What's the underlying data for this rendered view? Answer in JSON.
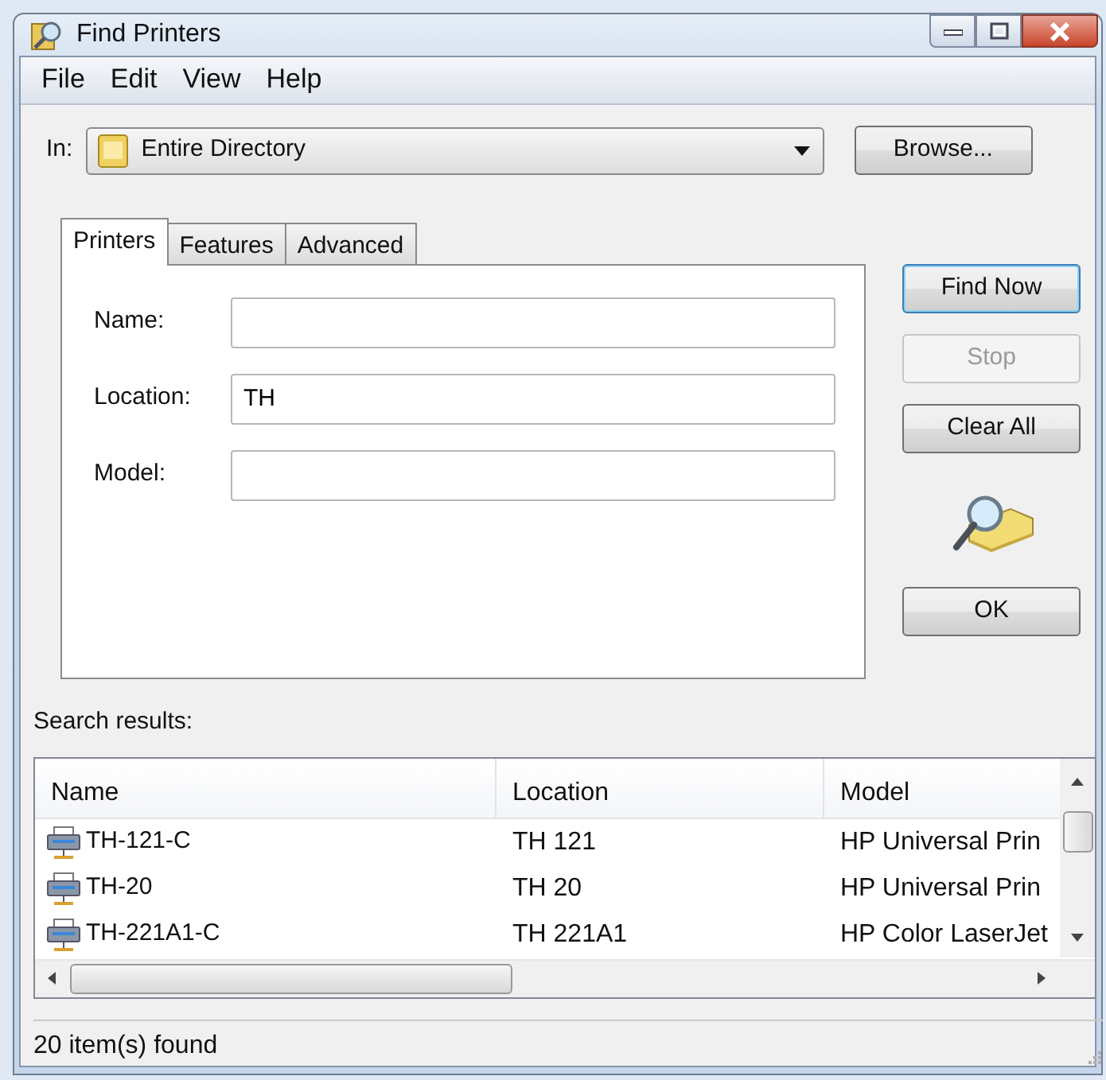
{
  "window": {
    "title": "Find Printers"
  },
  "menu": [
    "File",
    "Edit",
    "View",
    "Help"
  ],
  "scope": {
    "label": "In:",
    "value": "Entire Directory"
  },
  "browse_button": "Browse...",
  "tabs": [
    {
      "label": "Printers",
      "selected": true
    },
    {
      "label": "Features",
      "selected": false
    },
    {
      "label": "Advanced",
      "selected": false
    }
  ],
  "fields": [
    {
      "label": "Name:"
    },
    {
      "label": "Location:",
      "value": "TH"
    },
    {
      "label": "Model:"
    }
  ],
  "buttons": [
    {
      "label": "Find Now",
      "default": true,
      "disabled": false
    },
    {
      "label": "Stop",
      "default": false,
      "disabled": true
    },
    {
      "label": "Clear All",
      "default": false,
      "disabled": false
    }
  ],
  "ok_button": "OK",
  "results_label": "Search results:",
  "table": {
    "columns": [
      "Name",
      "Location",
      "Model"
    ],
    "rows": [
      [
        "TH-121-C",
        "TH 121",
        "HP Universal Prin"
      ],
      [
        "TH-20",
        "TH 20",
        "HP Universal Prin"
      ],
      [
        "TH-221A1-C",
        "TH 221A1",
        "HP Color LaserJet"
      ]
    ]
  },
  "status_bar": "20 item(s) found"
}
